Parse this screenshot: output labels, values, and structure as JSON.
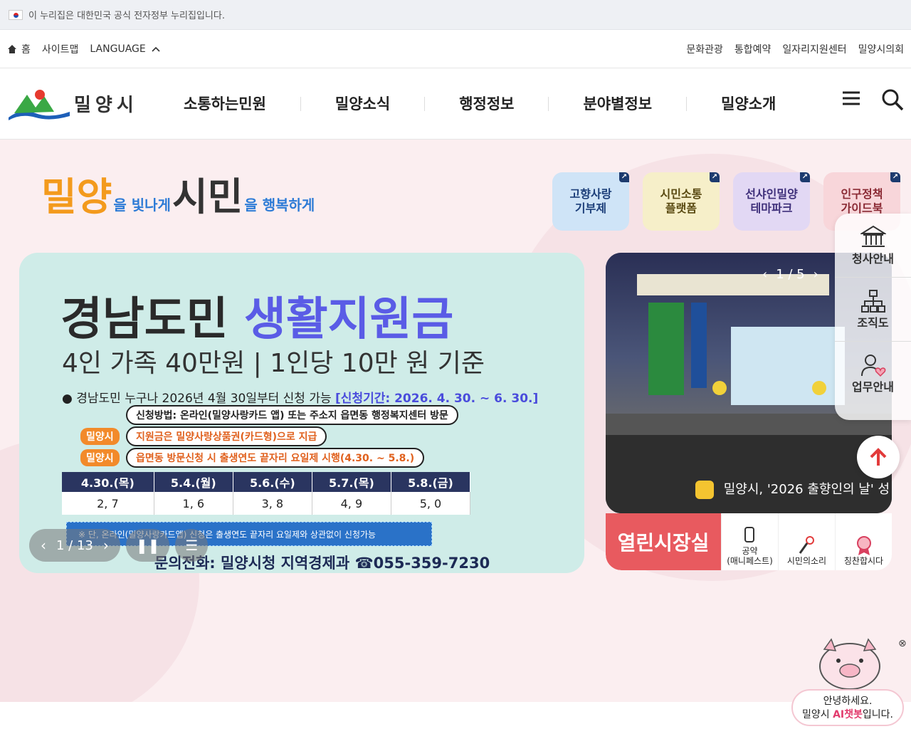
{
  "notice": {
    "text": "이 누리집은 대한민국 공식 전자정부 누리집입니다."
  },
  "util": {
    "home": "홈",
    "sitemap": "사이트맵",
    "language": "LANGUAGE",
    "links": [
      "문화관광",
      "통합예약",
      "일자리지원센터",
      "밀양시의회"
    ]
  },
  "header": {
    "logo_text": "밀양시",
    "menu": [
      "소통하는민원",
      "밀양소식",
      "행정정보",
      "분야별정보",
      "밀양소개"
    ]
  },
  "slogan": {
    "p1": "밀양",
    "p2": "을 빛나게",
    "p3": "시민",
    "p4": "을 행복하게"
  },
  "quick": [
    {
      "label": "고향사랑\n기부제",
      "color": "#cfe4f7"
    },
    {
      "label": "시민소통\n플랫폼",
      "color": "#f6efc9"
    },
    {
      "label": "선샤인밀양\n테마파크",
      "color": "#e2d8f4"
    },
    {
      "label": "인구정책\n가이드북",
      "color": "#f8d6da"
    }
  ],
  "banner": {
    "title_a": "경남도민 ",
    "title_b": "생활지원금",
    "subtitle": "4인 가족 40만원 | 1인당 10만 원 기준",
    "line1": "경남도민 누구나 2026년 4월 30일부터 신청 가능 ",
    "line1_period": "[신청기간: 2026. 4. 30. ~ 6. 30.]",
    "method": "신청방법: 온라인(밀양사랑카드 앱) 또는 주소지 읍면동 행정복지센터 방문",
    "tag1": "밀양시",
    "pay": "지원금은 밀양사랑상품권(카드형)으로 지급",
    "tag2": "밀양시",
    "visit": "읍면동 방문신청 시 출생연도 끝자리 요일제 시행(4.30. ~ 5.8.)",
    "table_head": [
      "4.30.(목)",
      "5.4.(월)",
      "5.6.(수)",
      "5.7.(목)",
      "5.8.(금)"
    ],
    "table_row": [
      "2, 7",
      "1, 6",
      "3, 8",
      "4, 9",
      "5, 0"
    ],
    "note": "※ 단, 온라인(밀양사랑카드앱) 신청은 출생연도 끝자리 요일제와 상관없이 신청가능",
    "footer": "문의전화: 밀양시청 지역경제과 ☎055-359-7230",
    "counter": "1 / 13"
  },
  "news": {
    "counter": "1 / 5",
    "caption": "밀양시, '2026 출향인의 날' 성"
  },
  "open": {
    "title": "열린시장실",
    "items": [
      "공약\n(매니페스트)",
      "시민의소리",
      "칭찬합시다"
    ]
  },
  "side": [
    "청사안내",
    "조직도",
    "업무안내"
  ],
  "chatbot": {
    "line1": "안녕하세요.",
    "prefix": "밀양시 ",
    "ai": "AI챗봇",
    "suffix": "입니다."
  },
  "colors": {
    "accent": "#e85a5f",
    "navy": "#2a3560",
    "violet": "#5a5ce6"
  }
}
